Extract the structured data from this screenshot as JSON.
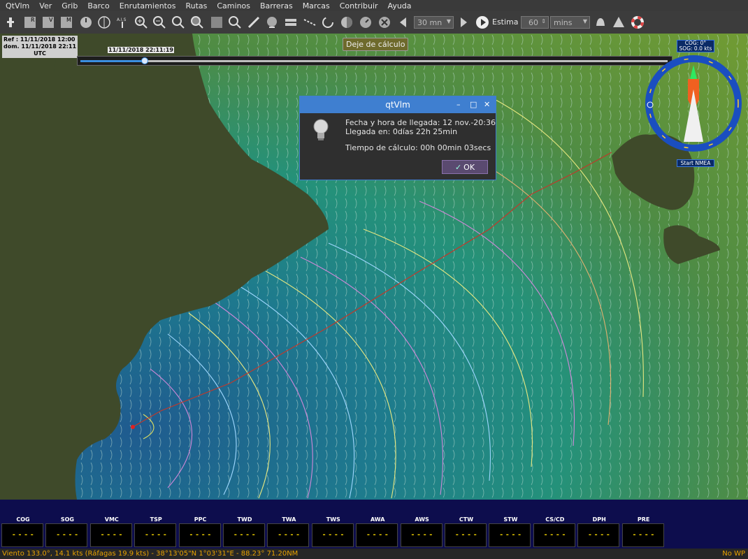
{
  "menu": [
    "QtVlm",
    "Ver",
    "Grib",
    "Barco",
    "Enrutamientos",
    "Rutas",
    "Caminos",
    "Barreras",
    "Marcas",
    "Contribuir",
    "Ayuda"
  ],
  "toolbar": {
    "time_step": "30 mn",
    "estima_label": "Estima",
    "estima_value": "60",
    "estima_unit": "mins"
  },
  "ref_box": {
    "line1": "Ref : 11/11/2018 12:00",
    "line2": "dom. 11/11/2018 22:11",
    "line3": "UTC"
  },
  "timeline": {
    "label": "11/11/2018 22:11:19",
    "progress": 0.11
  },
  "stop_calc_button": "Deje de cálculo",
  "dialog": {
    "title": "qtVlm",
    "arrival": "Fecha y hora de llegada: 12 nov.-20:36",
    "arrival_in": "Llegada en: 0días 22h 25min",
    "calc_time": "Tiempo de cálculo: 00h 00min 03secs",
    "ok": "OK"
  },
  "compass": {
    "cog": "COG: 0°",
    "sog": "SOG: 0.0 kts",
    "start_nmea": "Start NMEA"
  },
  "instruments": [
    {
      "label": "COG",
      "value": "- - - -"
    },
    {
      "label": "SOG",
      "value": "- - - -"
    },
    {
      "label": "VMC",
      "value": "- - - -"
    },
    {
      "label": "TSP",
      "value": "- - - -"
    },
    {
      "label": "PPC",
      "value": "- - - -"
    },
    {
      "label": "TWD",
      "value": "- - - -"
    },
    {
      "label": "TWA",
      "value": "- - - -"
    },
    {
      "label": "TWS",
      "value": "- - - -"
    },
    {
      "label": "AWA",
      "value": "- - - -"
    },
    {
      "label": "AWS",
      "value": "- - - -"
    },
    {
      "label": "CTW",
      "value": "- - - -"
    },
    {
      "label": "STW",
      "value": "- - - -"
    },
    {
      "label": "CS/CD",
      "value": "- - - -"
    },
    {
      "label": "DPH",
      "value": "- - - -"
    },
    {
      "label": "PRE",
      "value": "- - - -"
    }
  ],
  "status": {
    "wind": "Viento 133.0°, 14.1 kts (Ráfagas 19.9 kts)  -  38°13'05\"N  1°03'31\"E - 88.23°  71.20NM",
    "wp": "No WP"
  },
  "colors": {
    "route": "#c0392b",
    "land": "#3f4a2a",
    "accent": "#3f7fd0"
  }
}
